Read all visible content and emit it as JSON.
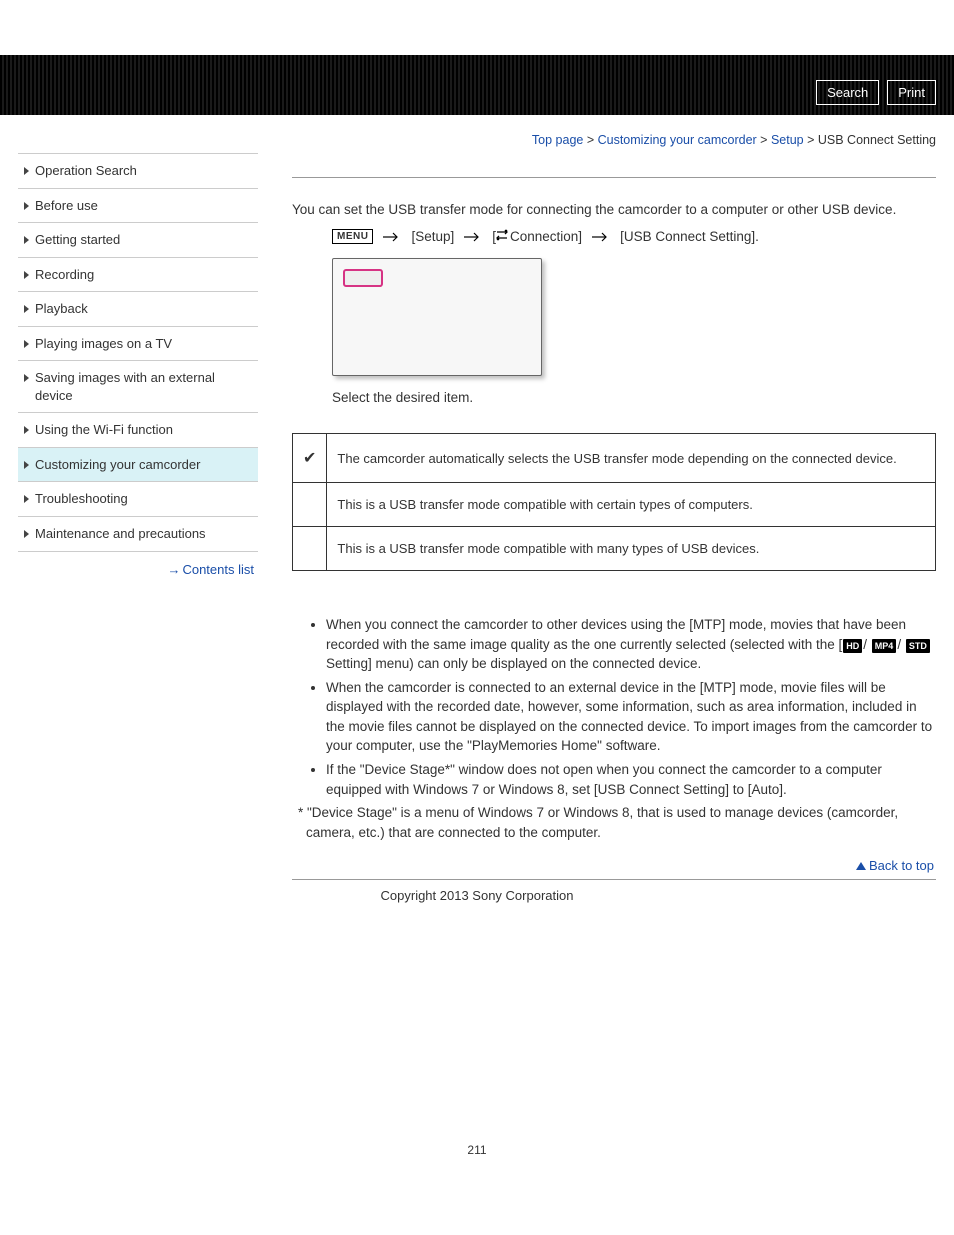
{
  "header": {
    "search": "Search",
    "print": "Print"
  },
  "breadcrumb": {
    "top": "Top page",
    "cat1": "Customizing your camcorder",
    "cat2": "Setup",
    "current": "USB Connect Setting",
    "sep": " > "
  },
  "sidebar": {
    "items": [
      "Operation Search",
      "Before use",
      "Getting started",
      "Recording",
      "Playback",
      "Playing images on a TV",
      "Saving images with an external device",
      "Using the Wi-Fi function",
      "Customizing your camcorder",
      "Troubleshooting",
      "Maintenance and precautions"
    ],
    "contents_list": "Contents list"
  },
  "main": {
    "intro": "You can set the USB transfer mode for connecting the camcorder to a computer or other USB device.",
    "menu_label": "MENU",
    "path_setup": "[Setup]",
    "path_conn": "Connection]",
    "path_conn_prefix": "[",
    "path_setting": "[USB Connect Setting].",
    "select_line": "Select the desired item.",
    "options": [
      {
        "mark": "✔",
        "desc": "The camcorder automatically selects the USB transfer mode depending on the connected device."
      },
      {
        "mark": "",
        "desc": "This is a USB transfer mode compatible with certain types of computers."
      },
      {
        "mark": "",
        "desc": "This is a USB transfer mode compatible with many types of USB devices."
      }
    ],
    "notes": {
      "n1a": "When you connect the camcorder to other devices using the [MTP] mode, movies that have been recorded with the same image quality as the one currently selected (selected with the [",
      "fmt1": "HD",
      "fmt2": "MP4",
      "fmt3": "STD",
      "n1b": "Setting] menu) can only be displayed on the connected device.",
      "n2": "When the camcorder is connected to an external device in the [MTP] mode, movie files will be displayed with the recorded date, however, some information, such as area information, included in the movie files cannot be displayed on the connected device. To import images from the camcorder to your computer, use the \"PlayMemories Home\" software.",
      "n3": "If the \"Device Stage*\" window does not open when you connect the camcorder to a computer equipped with Windows 7 or Windows 8, set [USB Connect Setting] to [Auto].",
      "ast": "* \"Device Stage\" is a menu of Windows 7 or Windows 8, that is used to manage devices (camcorder, camera, etc.) that are connected to the computer."
    },
    "back_to_top": "Back to top"
  },
  "footer": {
    "copyright": "Copyright 2013 Sony Corporation",
    "page": "211"
  }
}
